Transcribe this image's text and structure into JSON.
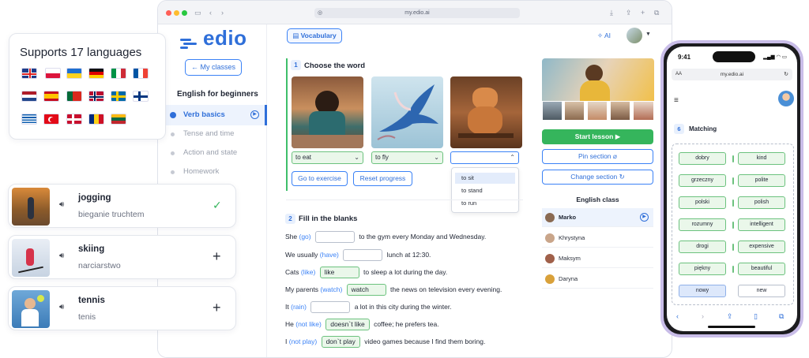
{
  "browser": {
    "url": "my.edio.ai"
  },
  "app": {
    "logo_text": "edio",
    "my_classes": "My classes",
    "course_title": "English for beginners",
    "nav": [
      {
        "label": "Verb basics",
        "active": true
      },
      {
        "label": "Tense and time",
        "active": false
      },
      {
        "label": "Action and state",
        "active": false
      },
      {
        "label": "Homework",
        "active": false
      }
    ],
    "vocabulary_button": "Vocabulary",
    "ai_label": "AI"
  },
  "section1": {
    "number": "1",
    "title": "Choose the word",
    "selects": [
      {
        "value": "to eat",
        "correct": true
      },
      {
        "value": "to fly",
        "correct": true
      },
      {
        "value": "",
        "correct": false,
        "open": true
      }
    ],
    "dropdown_options": [
      "to sit",
      "to stand",
      "to run"
    ],
    "go_to_exercise": "Go to exercise",
    "reset_progress": "Reset progress"
  },
  "section2": {
    "number": "2",
    "title": "Fill in the blanks",
    "lines": [
      {
        "pre": "She",
        "hint": "(go)",
        "answer": "",
        "post": "to the gym every Monday and Wednesday."
      },
      {
        "pre": "We usually",
        "hint": "(have)",
        "answer": "",
        "post": "lunch at 12:30."
      },
      {
        "pre": "Cats",
        "hint": "(like)",
        "answer": "like",
        "post": "to sleep a lot during the day."
      },
      {
        "pre": "My parents",
        "hint": "(watch)",
        "answer": "watch",
        "post": "the news on television every evening."
      },
      {
        "pre": "It",
        "hint": "(rain)",
        "answer": "",
        "post": "a lot in this city during the winter."
      },
      {
        "pre": "He",
        "hint": "(not like)",
        "answer": "doesn`t like",
        "post": "coffee; he prefers tea."
      },
      {
        "pre": "I",
        "hint": "(not play)",
        "answer": "don`t play",
        "post": "video games because I find them boring."
      }
    ]
  },
  "right_panel": {
    "start_lesson": "Start lesson",
    "pin_section": "Pin section",
    "change_section": "Change section",
    "class_title": "English class",
    "students": [
      {
        "name": "Marko",
        "active": true,
        "color": "#8a6a52"
      },
      {
        "name": "Khrystyna",
        "active": false,
        "color": "#c9a58a"
      },
      {
        "name": "Maksym",
        "active": false,
        "color": "#a0604a"
      },
      {
        "name": "Daryna",
        "active": false,
        "color": "#d9a13a"
      }
    ]
  },
  "languages_card": {
    "title": "Supports 17 languages"
  },
  "word_cards": [
    {
      "en": "jogging",
      "pl": "bieganie truchtem",
      "action": "✓",
      "done": true
    },
    {
      "en": "skiing",
      "pl": "narciarstwo",
      "action": "+",
      "done": false
    },
    {
      "en": "tennis",
      "pl": "tenis",
      "action": "+",
      "done": false
    }
  ],
  "phone": {
    "time": "9:41",
    "url": "my.edio.ai",
    "aa": "AA",
    "section_number": "6",
    "section_title": "Matching",
    "pairs": [
      {
        "left": "dobry",
        "right": "kind"
      },
      {
        "left": "grzeczny",
        "right": "polite"
      },
      {
        "left": "polski",
        "right": "polish"
      },
      {
        "left": "rozumny",
        "right": "intelligent"
      },
      {
        "left": "drogi",
        "right": "expensive"
      },
      {
        "left": "piękny",
        "right": "beautiful"
      },
      {
        "left": "nowy",
        "right": "new"
      }
    ]
  }
}
